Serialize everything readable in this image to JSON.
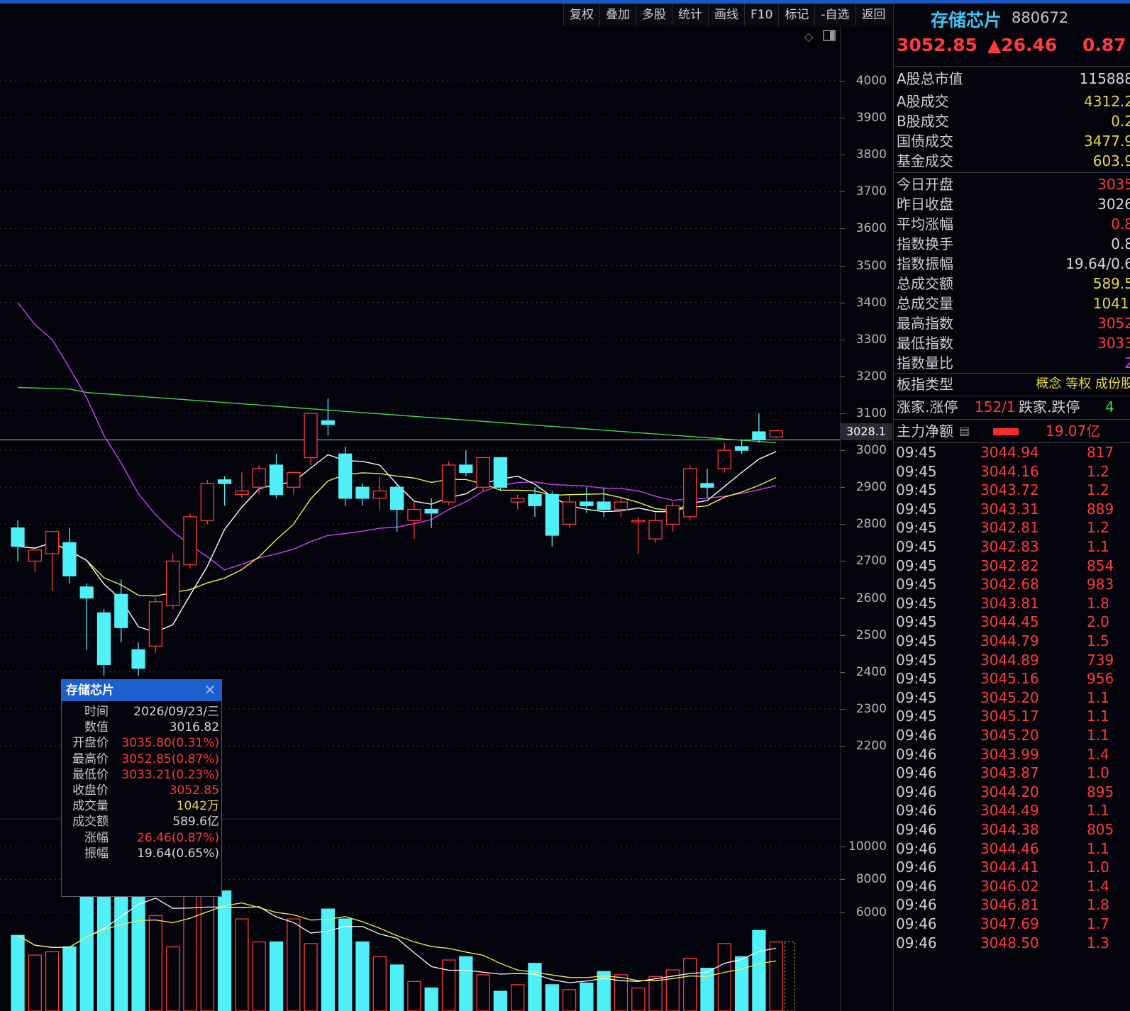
{
  "toolbar": [
    "复权",
    "叠加",
    "多股",
    "统计",
    "画线",
    "F10",
    "标记",
    "-自选",
    "返回"
  ],
  "chart": {
    "price_axis": [
      "4000",
      "3900",
      "3800",
      "3700",
      "3600",
      "3500",
      "3400",
      "3300",
      "3200",
      "3100",
      "3000",
      "2900",
      "2800",
      "2700",
      "2600",
      "2500",
      "2400",
      "2300",
      "2200"
    ],
    "volume_axis": [
      "10000",
      "8000",
      "6000"
    ],
    "current_price_tag": "3028.1"
  },
  "chart_data": {
    "type": "candlestick",
    "price_ylim": [
      2200,
      4000
    ],
    "volume_ylim": [
      0,
      10000
    ],
    "candles": [
      {
        "o": 2790,
        "h": 2810,
        "c": 2740,
        "l": 2700
      },
      {
        "o": 2700,
        "h": 2720,
        "c": 2730,
        "l": 2670
      },
      {
        "o": 2720,
        "h": 2780,
        "c": 2780,
        "l": 2620
      },
      {
        "o": 2750,
        "h": 2790,
        "c": 2660,
        "l": 2640
      },
      {
        "o": 2630,
        "h": 2640,
        "c": 2600,
        "l": 2460
      },
      {
        "o": 2560,
        "h": 2570,
        "c": 2420,
        "l": 2390
      },
      {
        "o": 2610,
        "h": 2650,
        "c": 2520,
        "l": 2480
      },
      {
        "o": 2460,
        "h": 2480,
        "c": 2410,
        "l": 2390
      },
      {
        "o": 2470,
        "h": 2600,
        "c": 2590,
        "l": 2450
      },
      {
        "o": 2580,
        "h": 2720,
        "c": 2700,
        "l": 2570
      },
      {
        "o": 2690,
        "h": 2830,
        "c": 2820,
        "l": 2680
      },
      {
        "o": 2810,
        "h": 2920,
        "c": 2910,
        "l": 2800
      },
      {
        "o": 2920,
        "h": 2930,
        "c": 2910,
        "l": 2850
      },
      {
        "o": 2880,
        "h": 2940,
        "c": 2890,
        "l": 2870
      },
      {
        "o": 2900,
        "h": 2960,
        "c": 2950,
        "l": 2880
      },
      {
        "o": 2960,
        "h": 2990,
        "c": 2880,
        "l": 2870
      },
      {
        "o": 2900,
        "h": 2940,
        "c": 2940,
        "l": 2880
      },
      {
        "o": 2980,
        "h": 3100,
        "c": 3100,
        "l": 2960
      },
      {
        "o": 3080,
        "h": 3140,
        "c": 3070,
        "l": 3040
      },
      {
        "o": 2990,
        "h": 3010,
        "c": 2870,
        "l": 2850
      },
      {
        "o": 2900,
        "h": 2910,
        "c": 2870,
        "l": 2850
      },
      {
        "o": 2870,
        "h": 2930,
        "c": 2890,
        "l": 2840
      },
      {
        "o": 2900,
        "h": 2910,
        "c": 2840,
        "l": 2780
      },
      {
        "o": 2810,
        "h": 2860,
        "c": 2840,
        "l": 2760
      },
      {
        "o": 2840,
        "h": 2870,
        "c": 2830,
        "l": 2790
      },
      {
        "o": 2860,
        "h": 2970,
        "c": 2960,
        "l": 2850
      },
      {
        "o": 2960,
        "h": 3000,
        "c": 2940,
        "l": 2930
      },
      {
        "o": 2900,
        "h": 2980,
        "c": 2980,
        "l": 2890
      },
      {
        "o": 2980,
        "h": 2980,
        "c": 2900,
        "l": 2890
      },
      {
        "o": 2860,
        "h": 2880,
        "c": 2870,
        "l": 2840
      },
      {
        "o": 2880,
        "h": 2900,
        "c": 2850,
        "l": 2820
      },
      {
        "o": 2880,
        "h": 2890,
        "c": 2770,
        "l": 2740
      },
      {
        "o": 2800,
        "h": 2880,
        "c": 2860,
        "l": 2790
      },
      {
        "o": 2860,
        "h": 2900,
        "c": 2850,
        "l": 2830
      },
      {
        "o": 2860,
        "h": 2900,
        "c": 2840,
        "l": 2820
      },
      {
        "o": 2840,
        "h": 2870,
        "c": 2860,
        "l": 2820
      },
      {
        "o": 2810,
        "h": 2820,
        "c": 2810,
        "l": 2720
      },
      {
        "o": 2760,
        "h": 2830,
        "c": 2810,
        "l": 2750
      },
      {
        "o": 2800,
        "h": 2860,
        "c": 2850,
        "l": 2780
      },
      {
        "o": 2820,
        "h": 2960,
        "c": 2950,
        "l": 2810
      },
      {
        "o": 2910,
        "h": 2950,
        "c": 2900,
        "l": 2870
      },
      {
        "o": 2950,
        "h": 3020,
        "c": 3000,
        "l": 2940
      },
      {
        "o": 3010,
        "h": 3030,
        "c": 3000,
        "l": 2990
      },
      {
        "o": 3050,
        "h": 3100,
        "c": 3030,
        "l": 3020
      },
      {
        "o": 3035.8,
        "h": 3052.85,
        "c": 3052.85,
        "l": 3033.21
      }
    ],
    "volumes": [
      4600,
      3400,
      3600,
      3900,
      7000,
      7200,
      7000,
      7300,
      5800,
      3900,
      7300,
      7300,
      7300,
      5600,
      4200,
      4200,
      5600,
      4100,
      6200,
      5600,
      4200,
      3300,
      2800,
      1800,
      1400,
      3100,
      3300,
      2200,
      1200,
      1600,
      2900,
      1600,
      1300,
      1700,
      2400,
      2200,
      1400,
      2100,
      2500,
      3200,
      2600,
      4100,
      3300,
      4900,
      4200
    ],
    "current_line": 3028.1
  },
  "popup": {
    "title": "存储芯片",
    "rows": [
      {
        "k": "时间",
        "v": "2026/09/23/三",
        "c": "white"
      },
      {
        "k": "数值",
        "v": "3016.82",
        "c": "white"
      },
      {
        "k": "开盘价",
        "v": "3035.80(0.31%)",
        "c": "red"
      },
      {
        "k": "最高价",
        "v": "3052.85(0.87%)",
        "c": "red"
      },
      {
        "k": "最低价",
        "v": "3033.21(0.23%)",
        "c": "red"
      },
      {
        "k": "收盘价",
        "v": "3052.85",
        "c": "red"
      },
      {
        "k": "成交量",
        "v": "1042万",
        "c": "yellow"
      },
      {
        "k": "成交额",
        "v": "589.6亿",
        "c": "white"
      },
      {
        "k": "涨幅",
        "v": "26.46(0.87%)",
        "c": "red"
      },
      {
        "k": "振幅",
        "v": "19.64(0.65%)",
        "c": "white"
      }
    ]
  },
  "panel": {
    "name": "存储芯片",
    "code": "880672",
    "price": "3052.85",
    "change": "▲26.46",
    "change_pct": "0.87",
    "stats": [
      {
        "k": "A股总市值",
        "v": "115888",
        "c": "white"
      },
      {
        "k": "A股成交",
        "v": "4312.2",
        "c": "yellow"
      },
      {
        "k": "B股成交",
        "v": "0.2",
        "c": "yellow"
      },
      {
        "k": "国债成交",
        "v": "3477.9",
        "c": "yellow"
      },
      {
        "k": "基金成交",
        "v": "603.9",
        "c": "yellow"
      },
      {
        "k": "今日开盘",
        "v": "3035",
        "c": "red"
      },
      {
        "k": "昨日收盘",
        "v": "3026",
        "c": "white"
      },
      {
        "k": "平均涨幅",
        "v": "0.8",
        "c": "red"
      },
      {
        "k": "指数换手",
        "v": "0.8",
        "c": "white"
      },
      {
        "k": "指数振幅",
        "v": "19.64/0.6",
        "c": "white"
      },
      {
        "k": "总成交额",
        "v": "589.5",
        "c": "yellow"
      },
      {
        "k": "总成交量",
        "v": "1041.",
        "c": "yellow"
      },
      {
        "k": "最高指数",
        "v": "3052",
        "c": "red"
      },
      {
        "k": "最低指数",
        "v": "3033",
        "c": "red"
      },
      {
        "k": "指数量比",
        "v": "2",
        "c": "purple"
      }
    ],
    "board_type_label": "板指类型",
    "board_types": "概念 等权 成份股",
    "up_label": "涨家.涨停",
    "up_value": "152/1",
    "down_label": "跌家.跌停",
    "down_value": "4",
    "main_net_label": "主力净额",
    "main_net_value": "19.07亿",
    "ticks": [
      {
        "t": "09:45",
        "p": "3044.94",
        "v": "817"
      },
      {
        "t": "09:45",
        "p": "3044.16",
        "v": "1.2"
      },
      {
        "t": "09:45",
        "p": "3043.72",
        "v": "1.2"
      },
      {
        "t": "09:45",
        "p": "3043.31",
        "v": "889"
      },
      {
        "t": "09:45",
        "p": "3042.81",
        "v": "1.2"
      },
      {
        "t": "09:45",
        "p": "3042.83",
        "v": "1.1"
      },
      {
        "t": "09:45",
        "p": "3042.82",
        "v": "854"
      },
      {
        "t": "09:45",
        "p": "3042.68",
        "v": "983"
      },
      {
        "t": "09:45",
        "p": "3043.81",
        "v": "1.8"
      },
      {
        "t": "09:45",
        "p": "3044.45",
        "v": "2.0"
      },
      {
        "t": "09:45",
        "p": "3044.79",
        "v": "1.5"
      },
      {
        "t": "09:45",
        "p": "3044.89",
        "v": "739"
      },
      {
        "t": "09:45",
        "p": "3045.16",
        "v": "956"
      },
      {
        "t": "09:45",
        "p": "3045.20",
        "v": "1.1"
      },
      {
        "t": "09:45",
        "p": "3045.17",
        "v": "1.1"
      },
      {
        "t": "09:46",
        "p": "3045.20",
        "v": "1.1"
      },
      {
        "t": "09:46",
        "p": "3043.99",
        "v": "1.4"
      },
      {
        "t": "09:46",
        "p": "3043.87",
        "v": "1.0"
      },
      {
        "t": "09:46",
        "p": "3044.20",
        "v": "895"
      },
      {
        "t": "09:46",
        "p": "3044.49",
        "v": "1.1"
      },
      {
        "t": "09:46",
        "p": "3044.38",
        "v": "805"
      },
      {
        "t": "09:46",
        "p": "3044.46",
        "v": "1.1"
      },
      {
        "t": "09:46",
        "p": "3044.41",
        "v": "1.0"
      },
      {
        "t": "09:46",
        "p": "3046.02",
        "v": "1.4"
      },
      {
        "t": "09:46",
        "p": "3046.81",
        "v": "1.8"
      },
      {
        "t": "09:46",
        "p": "3047.69",
        "v": "1.7"
      },
      {
        "t": "09:46",
        "p": "3048.50",
        "v": "1.3"
      }
    ]
  },
  "colors": {
    "up": "#ff3b3b",
    "down": "#4ff0f8",
    "ma5": "#ffffff",
    "ma10": "#f0f04a",
    "ma20": "#d040f0",
    "ma60": "#3cd84a"
  }
}
